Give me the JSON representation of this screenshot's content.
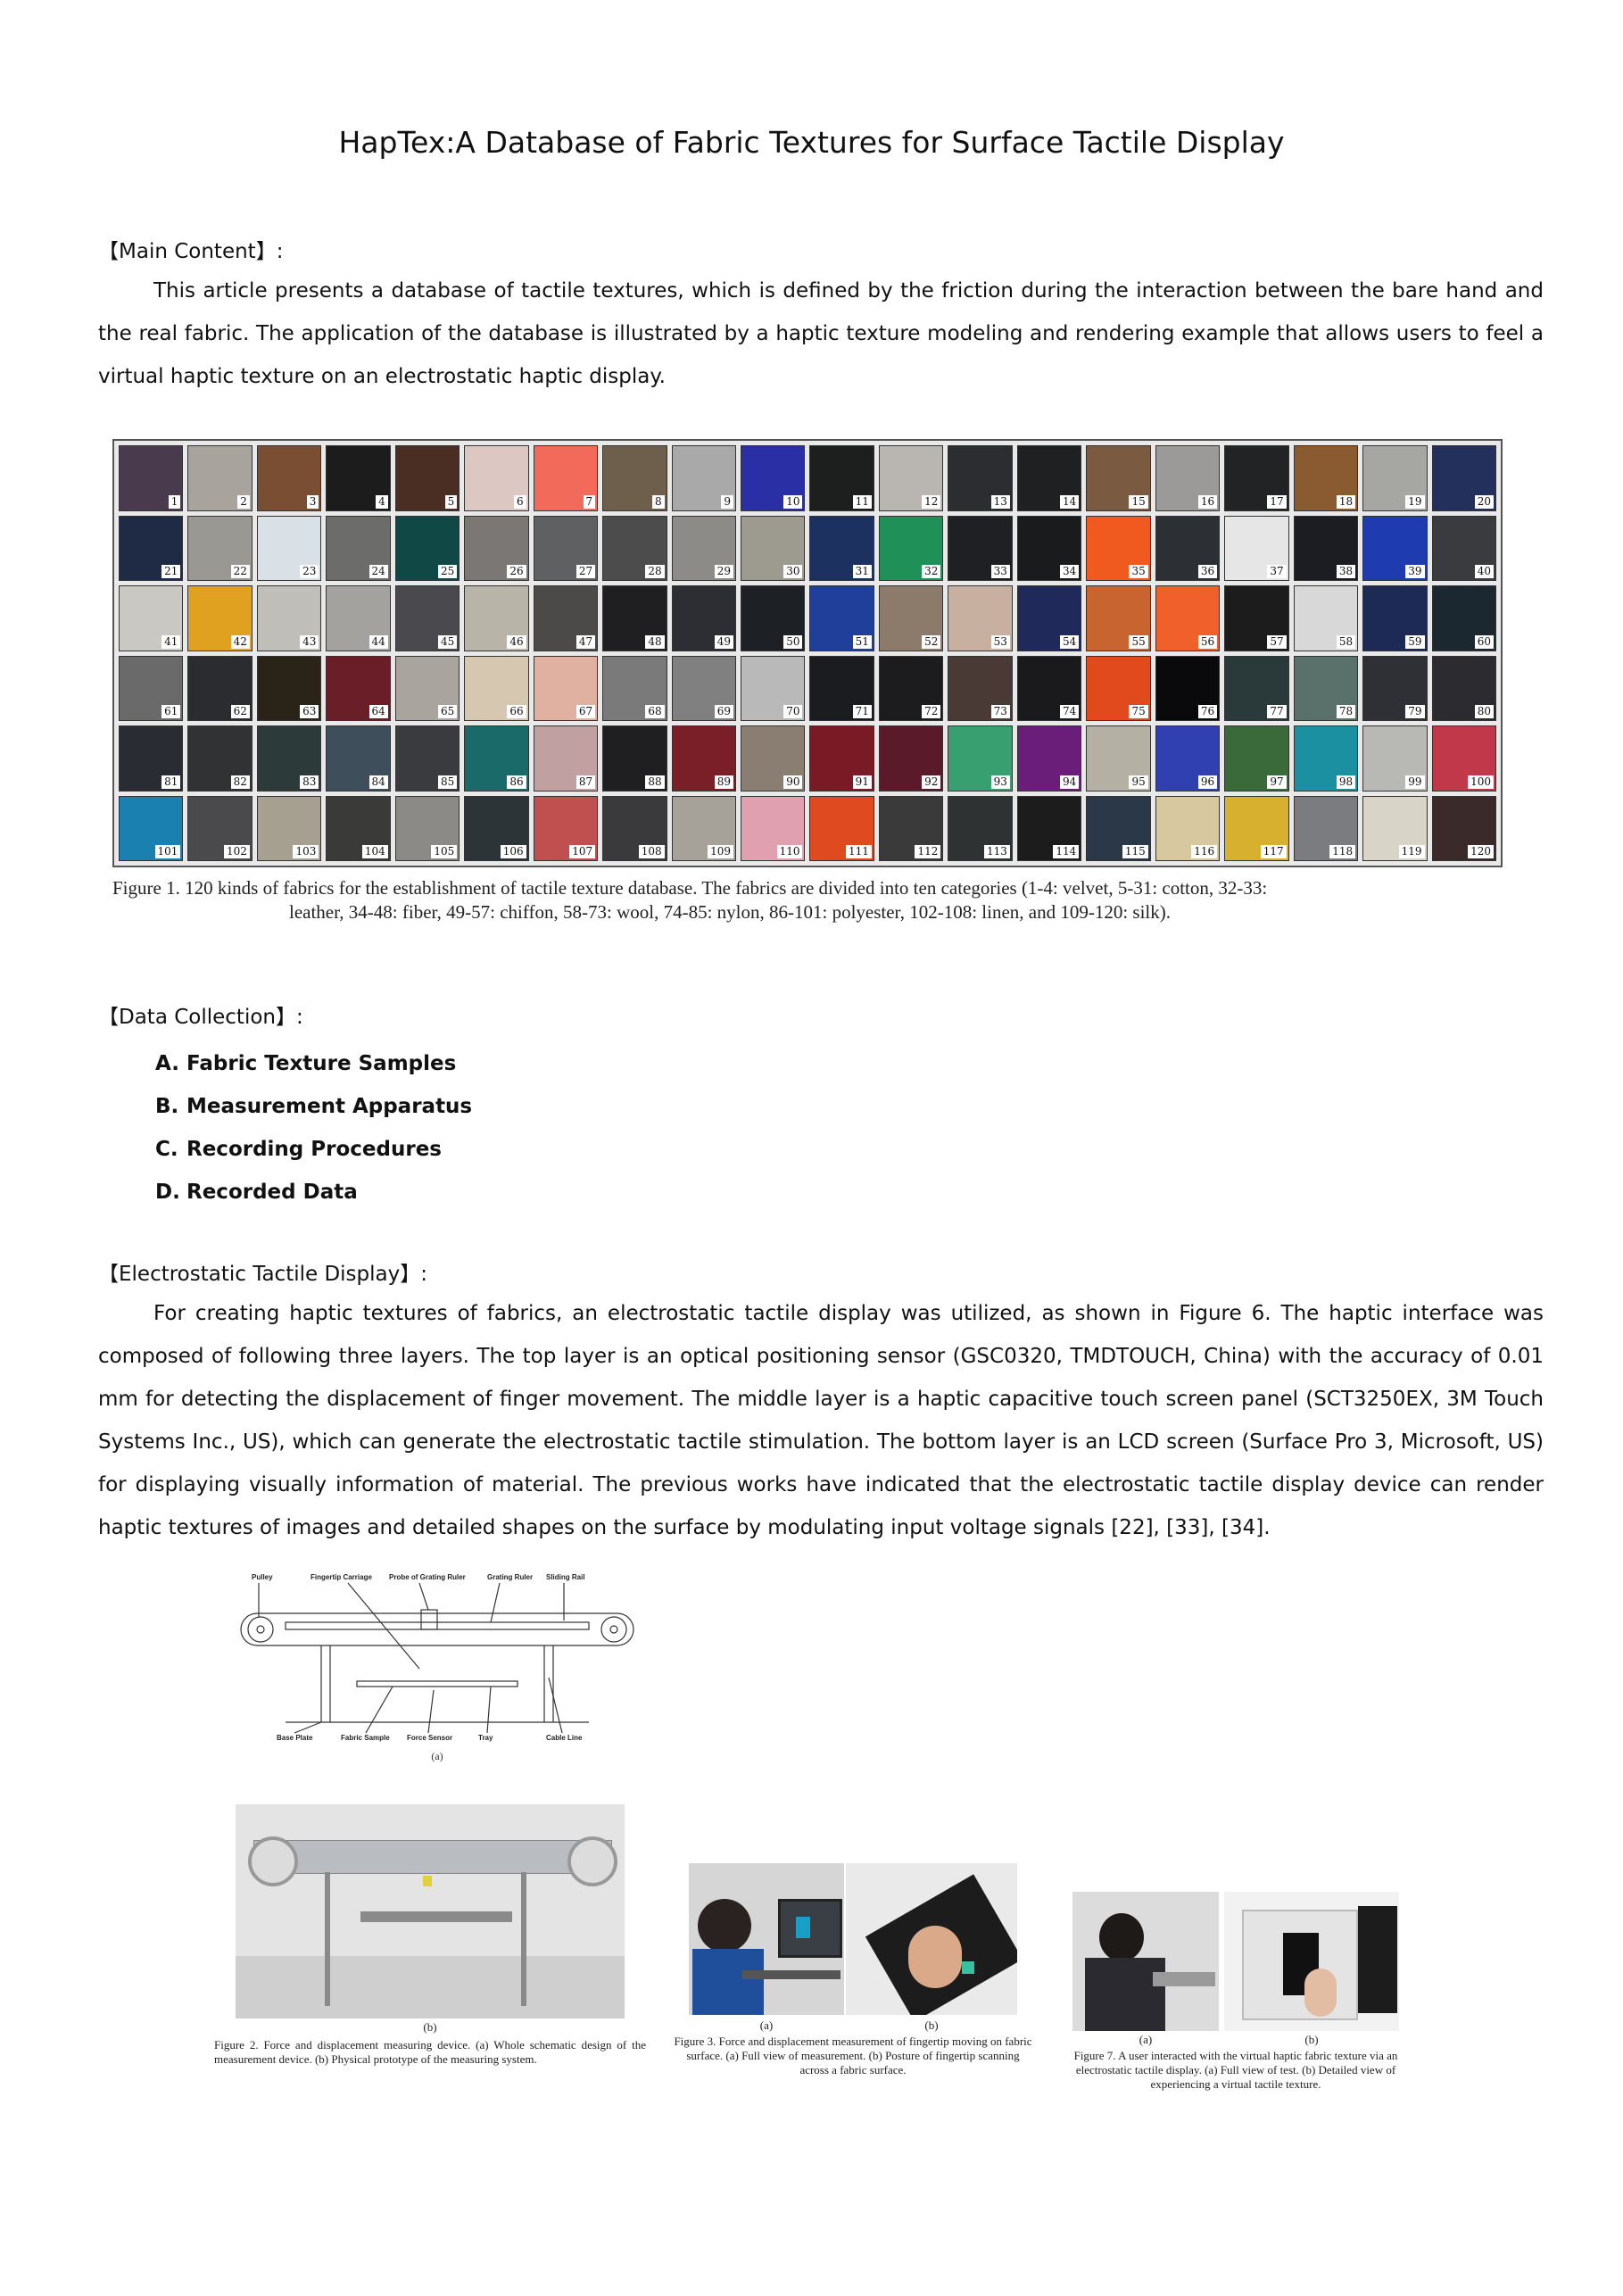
{
  "title": "HapTex:A Database of Fabric Textures for Surface Tactile Display",
  "main_content": {
    "heading": "【Main Content】:",
    "text": "This article presents a database of tactile textures, which is defined by the friction during the interaction between the bare hand and the real fabric. The application of the database is illustrated by a haptic texture modeling and rendering example that allows users to feel a virtual haptic texture on an electrostatic haptic display."
  },
  "figure1": {
    "labels": [
      "1",
      "2",
      "3",
      "4",
      "5",
      "6",
      "7",
      "8",
      "9",
      "10",
      "11",
      "12",
      "13",
      "14",
      "15",
      "16",
      "17",
      "18",
      "19",
      "20",
      "21",
      "22",
      "23",
      "24",
      "25",
      "26",
      "27",
      "28",
      "29",
      "30",
      "31",
      "32",
      "33",
      "34",
      "35",
      "36",
      "37",
      "38",
      "39",
      "40",
      "41",
      "42",
      "43",
      "44",
      "45",
      "46",
      "47",
      "48",
      "49",
      "50",
      "51",
      "52",
      "53",
      "54",
      "55",
      "56",
      "57",
      "58",
      "59",
      "60",
      "61",
      "62",
      "63",
      "64",
      "65",
      "66",
      "67",
      "68",
      "69",
      "70",
      "71",
      "72",
      "73",
      "74",
      "75",
      "76",
      "77",
      "78",
      "79",
      "80",
      "81",
      "82",
      "83",
      "84",
      "85",
      "86",
      "87",
      "88",
      "89",
      "90",
      "91",
      "92",
      "93",
      "94",
      "95",
      "96",
      "97",
      "98",
      "99",
      "100",
      "101",
      "102",
      "103",
      "104",
      "105",
      "106",
      "107",
      "108",
      "109",
      "110",
      "111",
      "112",
      "113",
      "114",
      "115",
      "116",
      "117",
      "118",
      "119",
      "120"
    ],
    "colors": [
      "#4a3a4e",
      "#a8a39c",
      "#7a4e33",
      "#1c1c1c",
      "#4a2e24",
      "#dcc7c2",
      "#f26a5a",
      "#6e5f4c",
      "#a9a9a9",
      "#2a2fa6",
      "#1d1f1f",
      "#b9b6b1",
      "#2b2d30",
      "#1f2022",
      "#7a5a40",
      "#9b9a98",
      "#222324",
      "#8a5a30",
      "#a6a6a2",
      "#23305c",
      "#1f2a44",
      "#9a9893",
      "#d9e1e6",
      "#6c6c6a",
      "#0f4844",
      "#7a7774",
      "#5f6062",
      "#4c4c4d",
      "#8d8b87",
      "#9d9a8f",
      "#1c3160",
      "#1f9058",
      "#1e2023",
      "#1a1b1d",
      "#f05a1e",
      "#2c2f34",
      "#e6e6e6",
      "#1c1d22",
      "#1e3bb0",
      "#3a3b3e",
      "#c9c8c2",
      "#e0a020",
      "#c0beb8",
      "#a4a29e",
      "#4a4a4e",
      "#b8b4a8",
      "#4c4a48",
      "#1f1f21",
      "#2c2e33",
      "#1d2025",
      "#1f3f9a",
      "#8c7a6a",
      "#c8b0a0",
      "#1f2a5a",
      "#c86430",
      "#f0602a",
      "#1c1c1c",
      "#d8d8d8",
      "#1e2a56",
      "#1c2830",
      "#6a6a6a",
      "#2a2c30",
      "#2a2418",
      "#6a1e28",
      "#a9a59e",
      "#d6c7b0",
      "#e0b0a0",
      "#7a7a7a",
      "#808080",
      "#b9b9b9",
      "#1a1c20",
      "#1c1c1f",
      "#4a3a36",
      "#1a1a1c",
      "#e04a1c",
      "#0a0a0c",
      "#2a3a3a",
      "#5a706a",
      "#2e3036",
      "#2c2c30",
      "#2a2c34",
      "#303234",
      "#2c3a3a",
      "#3e4e5a",
      "#3a3b3e",
      "#1a6a6a",
      "#c0a0a0",
      "#1f1f22",
      "#7a1e28",
      "#8a7e72",
      "#7a1a24",
      "#5a1a2a",
      "#38a070",
      "#6a1e7a",
      "#b4b0a4",
      "#3040b0",
      "#3a6a3a",
      "#1a90a0",
      "#b8b8b4",
      "#c0384a",
      "#1a80b0",
      "#4a4a4c",
      "#a6a090",
      "#3a3a38",
      "#8c8a86",
      "#2c3438",
      "#c05050",
      "#3a3a3c",
      "#a6a29a",
      "#e0a0b0",
      "#e04a20",
      "#3a3a3a",
      "#2e3232",
      "#1c1c1c",
      "#2a3848",
      "#d8c8a0",
      "#d8b030",
      "#7a7c80",
      "#d8d4c8",
      "#3a2a2a"
    ],
    "caption_line1": "Figure 1.    120 kinds of fabrics for the establishment of tactile texture database. The fabrics are divided into ten categories (1-4: velvet, 5-31: cotton, 32-33:",
    "caption_line2": "leather, 34-48: fiber, 49-57: chiffon, 58-73: wool, 74-85: nylon, 86-101: polyester, 102-108: linen, and 109-120: silk)."
  },
  "data_collection": {
    "heading": "【Data Collection】:",
    "items": [
      {
        "letter": "A.",
        "text": "Fabric Texture Samples"
      },
      {
        "letter": "B.",
        "text": "Measurement Apparatus"
      },
      {
        "letter": "C.",
        "text": "Recording Procedures"
      },
      {
        "letter": "D.",
        "text": "Recorded Data"
      }
    ]
  },
  "electrostatic": {
    "heading": "【Electrostatic Tactile Display】:",
    "text": "For creating haptic textures of fabrics, an electrostatic tactile display was utilized, as shown in Figure 6. The haptic interface was composed of following three layers. The top layer is an optical positioning sensor (GSC0320, TMDTOUCH, China) with the accuracy of 0.01 mm for detecting the displacement of finger movement. The middle layer is a haptic capacitive touch screen panel (SCT3250EX, 3M Touch Systems Inc., US), which can generate the electrostatic tactile stimulation. The bottom layer is an LCD screen (Surface Pro 3, Microsoft, US) for displaying visually information of material. The previous works have indicated that the electrostatic tactile display device can render haptic textures of images and detailed shapes on the surface by modulating input voltage signals [22], [33], [34]."
  },
  "figure2": {
    "schematic_labels": {
      "pulley": "Pulley",
      "fingertip_carriage": "Fingertip Carriage",
      "probe": "Probe of Grating Ruler",
      "grating_ruler": "Grating Ruler",
      "sliding_rail": "Sliding Rail",
      "base_plate": "Base Plate",
      "fabric_sample": "Fabric Sample",
      "force_sensor": "Force Sensor",
      "tray": "Tray",
      "cable_line": "Cable Line"
    },
    "sub_a": "(a)",
    "sub_b": "(b)",
    "caption": "Figure 2.    Force and displacement measuring device. (a) Whole schematic design of the measurement device. (b) Physical prototype of the measuring system."
  },
  "figure3": {
    "sub_a": "(a)",
    "sub_b": "(b)",
    "caption": "Figure 3.    Force and displacement measurement of fingertip moving on fabric surface. (a) Full view of measurement. (b) Posture of fingertip scanning across a fabric surface."
  },
  "figure7": {
    "sub_a": "(a)",
    "sub_b": "(b)",
    "caption": "Figure 7.    A user interacted with the virtual haptic fabric texture via an electrostatic tactile display. (a) Full view of test. (b) Detailed view of experiencing a virtual tactile texture."
  }
}
